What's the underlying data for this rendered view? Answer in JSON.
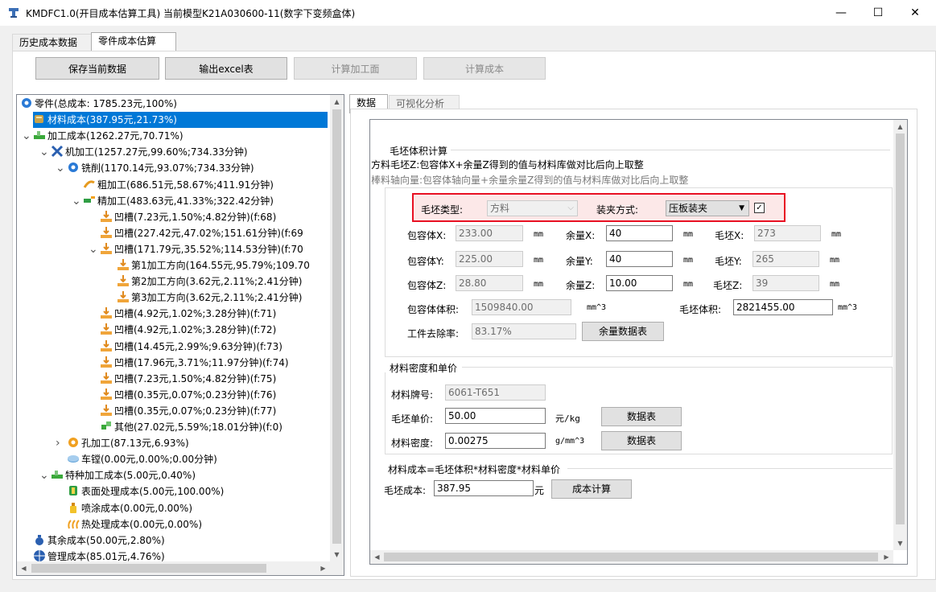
{
  "window": {
    "title": "KMDFC1.0(开目成本估算工具)   当前模型K21A030600-11(数字下变频盒体)",
    "minimize": "—",
    "maximize": "☐",
    "close": "✕"
  },
  "top_tabs": [
    "历史成本数据",
    "零件成本估算"
  ],
  "toolbar": {
    "save": "保存当前数据",
    "export": "输出excel表",
    "calc_face": "计算加工面",
    "calc_cost": "计算成本"
  },
  "tree": {
    "items": [
      {
        "label": "零件(总成本: 1785.23元,100%)",
        "icon": "gear-icon"
      },
      {
        "label": "材料成本(387.95元,21.73%)",
        "icon": "material-icon"
      },
      {
        "label": "加工成本(1262.27元,70.71%)",
        "icon": "machining-icon"
      },
      {
        "label": "机加工(1257.27元,99.60%;734.33分钟)",
        "icon": "tools-icon"
      },
      {
        "label": "铣削(1170.14元,93.07%;734.33分钟)",
        "icon": "gear-icon"
      },
      {
        "label": "粗加工(686.51元,58.67%;411.91分钟)",
        "icon": "rough-icon"
      },
      {
        "label": "精加工(483.63元,41.33%;322.42分钟)",
        "icon": "finish-icon"
      },
      {
        "label": "凹槽(7.23元,1.50%;4.82分钟)(f:68)",
        "icon": "groove-icon"
      },
      {
        "label": "凹槽(227.42元,47.02%;151.61分钟)(f:69",
        "icon": "groove-icon"
      },
      {
        "label": "凹槽(171.79元,35.52%;114.53分钟)(f:70",
        "icon": "groove-icon"
      },
      {
        "label": "第1加工方向(164.55元,95.79%;109.70",
        "icon": "groove-icon"
      },
      {
        "label": "第2加工方向(3.62元,2.11%;2.41分钟)",
        "icon": "groove-icon"
      },
      {
        "label": "第3加工方向(3.62元,2.11%;2.41分钟)",
        "icon": "groove-icon"
      },
      {
        "label": "凹槽(4.92元,1.02%;3.28分钟)(f:71)",
        "icon": "groove-icon"
      },
      {
        "label": "凹槽(4.92元,1.02%;3.28分钟)(f:72)",
        "icon": "groove-icon"
      },
      {
        "label": "凹槽(14.45元,2.99%;9.63分钟)(f:73)",
        "icon": "groove-icon"
      },
      {
        "label": "凹槽(17.96元,3.71%;11.97分钟)(f:74)",
        "icon": "groove-icon"
      },
      {
        "label": "凹槽(7.23元,1.50%;4.82分钟)(f:75)",
        "icon": "groove-icon"
      },
      {
        "label": "凹槽(0.35元,0.07%;0.23分钟)(f:76)",
        "icon": "groove-icon"
      },
      {
        "label": "凹槽(0.35元,0.07%;0.23分钟)(f:77)",
        "icon": "groove-icon"
      },
      {
        "label": "其他(27.02元,5.59%;18.01分钟)(f:0)",
        "icon": "puzzle-icon"
      },
      {
        "label": "孔加工(87.13元,6.93%)",
        "icon": "gear-orange-icon"
      },
      {
        "label": "车镗(0.00元,0.00%;0.00分钟)",
        "icon": "disc-icon"
      },
      {
        "label": "特种加工成本(5.00元,0.40%)",
        "icon": "machining-icon"
      },
      {
        "label": "表面处理成本(5.00元,100.00%)",
        "icon": "surface-icon"
      },
      {
        "label": "喷涂成本(0.00元,0.00%)",
        "icon": "spray-icon"
      },
      {
        "label": "热处理成本(0.00元,0.00%)",
        "icon": "heat-icon"
      },
      {
        "label": "其余成本(50.00元,2.80%)",
        "icon": "moneybag-icon"
      },
      {
        "label": "管理成本(85.01元,4.76%)",
        "icon": "globe-icon"
      }
    ]
  },
  "right_tabs": [
    "数据",
    "可视化分析"
  ],
  "blank": {
    "section_title": "毛坯体积计算",
    "desc1": "方料毛坯Z:包容体X+余量Z得到的值与材料库做对比后向上取整",
    "desc2": "棒料轴向量:包容体轴向量+余量余量Z得到的值与材料库做对比后向上取整",
    "type_label": "毛坯类型:",
    "type_value": "方料",
    "clamp_label": "装夹方式:",
    "clamp_value": "压板装夹",
    "bx_label": "包容体X:",
    "bx": "233.00",
    "unit_mm": "mm",
    "mx_label": "余量X:",
    "mx": "40",
    "px_label": "毛坯X:",
    "px": "273",
    "by_label": "包容体Y:",
    "by": "225.00",
    "my_label": "余量Y:",
    "my": "40",
    "py_label": "毛坯Y:",
    "py": "265",
    "bz_label": "包容体Z:",
    "bz": "28.80",
    "mz_label": "余量Z:",
    "mz": "10.00",
    "pz_label": "毛坯Z:",
    "pz": "39",
    "bvol_label": "包容体体积:",
    "bvol": "1509840.00",
    "unit_mm3": "mm^3",
    "pvol_label": "毛坯体积:",
    "pvol": "2821455.00",
    "rate_label": "工件去除率:",
    "rate": "83.17%",
    "allowance_btn": "余量数据表"
  },
  "material": {
    "section_title": "材料密度和单价",
    "grade_label": "材料牌号:",
    "grade": "6061-T651",
    "price_label": "毛坯单价:",
    "price": "50.00",
    "price_unit": "元/kg",
    "price_btn": "数据表",
    "density_label": "材料密度:",
    "density": "0.00275",
    "density_unit": "g/mm^3",
    "density_btn": "数据表"
  },
  "cost": {
    "section_title": "材料成本=毛坯体积*材料密度*材料单价",
    "label": "毛坯成本:",
    "value": "387.95",
    "unit": "元",
    "btn": "成本计算"
  },
  "colors": {
    "selection": "#0078d7",
    "highlight_border": "#e81123",
    "highlight_fill": "#fce8e8"
  }
}
